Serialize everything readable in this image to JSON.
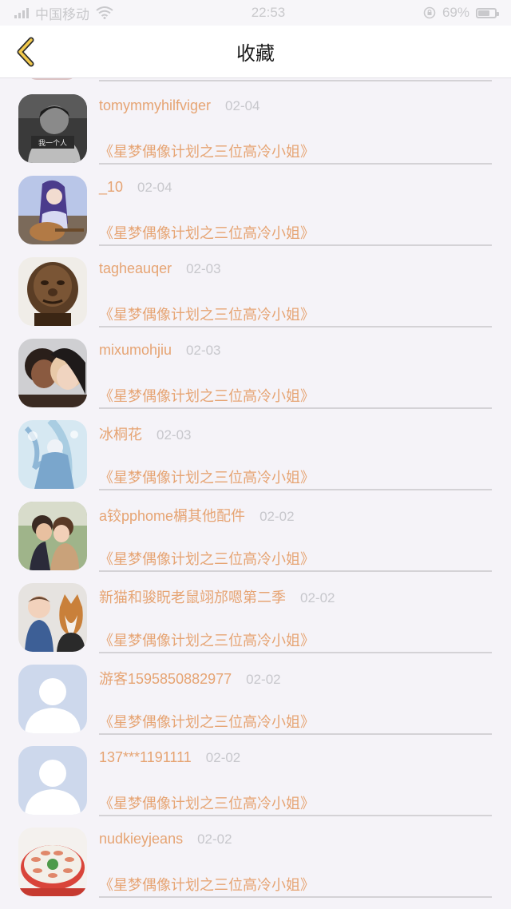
{
  "status_bar": {
    "carrier": "中国移动",
    "time": "22:53",
    "battery": "69%"
  },
  "header": {
    "title": "收藏"
  },
  "items": [
    {
      "username": "tomymmyhilfviger",
      "date": "02-04",
      "work": "《星梦偶像计划之三位高冷小姐》",
      "avatar_text": "我一个人"
    },
    {
      "username": "_10",
      "date": "02-04",
      "work": "《星梦偶像计划之三位高冷小姐》"
    },
    {
      "username": "tagheauqer",
      "date": "02-03",
      "work": "《星梦偶像计划之三位高冷小姐》"
    },
    {
      "username": "mixumohjiu",
      "date": "02-03",
      "work": "《星梦偶像计划之三位高冷小姐》"
    },
    {
      "username": "冰桐花",
      "date": "02-03",
      "work": "《星梦偶像计划之三位高冷小姐》"
    },
    {
      "username": "a铰pphome榍其他配件",
      "date": "02-02",
      "work": "《星梦偶像计划之三位高冷小姐》"
    },
    {
      "username": "新猫和骏眖老鼠翊邡嗯第二季",
      "date": "02-02",
      "work": "《星梦偶像计划之三位高冷小姐》"
    },
    {
      "username": "游客1595850882977",
      "date": "02-02",
      "work": "《星梦偶像计划之三位高冷小姐》"
    },
    {
      "username": "137***1191111",
      "date": "02-02",
      "work": "《星梦偶像计划之三位高冷小姐》"
    },
    {
      "username": "nudkieyjeans",
      "date": "02-02",
      "work": "《星梦偶像计划之三位高冷小姐》"
    }
  ]
}
